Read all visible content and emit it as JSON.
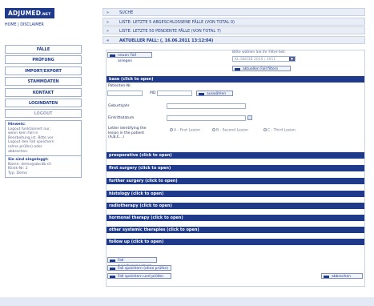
{
  "logo": {
    "text": "ADJUMED",
    "suffix": ".NET"
  },
  "toplinks": {
    "home": "HOME",
    "sep": "|",
    "disclaimer": "DISCLAIMER"
  },
  "nav": [
    {
      "label": "FÄLLE",
      "name": "nav-faelle"
    },
    {
      "label": "PRÜFUNG",
      "name": "nav-pruefung"
    },
    {
      "label": "IMPORT/EXPORT",
      "name": "nav-import-export"
    },
    {
      "label": "STAMMDATEN",
      "name": "nav-stammdaten"
    },
    {
      "label": "KONTAKT",
      "name": "nav-kontakt"
    },
    {
      "label": "LOGINDATEN",
      "name": "nav-logindaten"
    },
    {
      "label": "LOGOUT",
      "name": "nav-logout"
    }
  ],
  "hint": {
    "title": "Hinweis:",
    "lines": [
      "Logout funktioniert nur,",
      "wenn kein Fall in",
      "Bearbeitung ist. Bitte vor",
      "Logout den Fall speichern",
      "(ohne prüfen) oder",
      "abbrechen."
    ]
  },
  "login": {
    "title": "Sie sind eingeloggt:",
    "name": "Name: demo@abcdb.ch",
    "clinic": "Klinik-Nr: 2",
    "type": "Typ: Demo"
  },
  "rows": [
    {
      "label": "SUCHE"
    },
    {
      "label": "LISTE: LETZTE 5 ABGESCHLOSSENE FÄLLE (VON TOTAL 0)"
    },
    {
      "label": "LISTE: LETZTE 50 PENDENTE FÄLLE (VON TOTAL 7)"
    },
    {
      "label": "AKTUELLER FALL: (, 16.06.2011 13:12:04)"
    }
  ],
  "toolbar": {
    "new_case": "neuen Fall anlegen",
    "filter_label": "Bitte wählen Sie Ihr Filter-Set:",
    "filter_value": "KL-SBCDB 2010 / 2011",
    "apply_filter": "aktuellen Fall filtern"
  },
  "base": {
    "header": "base (click to open)",
    "patient_nr": "Patienten-Nr.",
    "pid": "PID",
    "select_btn": "auswählen",
    "birth_year": "Geburtsjahr",
    "entry_date": "Eintrittsdatum",
    "letter_label_1": "Letter identifying the",
    "letter_label_2": "lesion in the patient",
    "letter_label_3": "(A,B,C...)",
    "opt_a": "A - First Lesion",
    "opt_b": "B - Second Lesion",
    "opt_c": "C - Third Lesion"
  },
  "sections": [
    {
      "label": "preoperative (click to open)"
    },
    {
      "label": "first surgery (click to open)"
    },
    {
      "label": "further surgery (click to open)"
    },
    {
      "label": "histology (click to open)"
    },
    {
      "label": "radiotherapy (click to open)"
    },
    {
      "label": "hormonal therapy (click to open)"
    },
    {
      "label": "other systemic therapies (click to open)"
    },
    {
      "label": "follow up (click to open)"
    }
  ],
  "actions": {
    "save_temp": "Fall zwischenspeichern",
    "save_no_check": "Fall speichern (ohne prüfen)",
    "save_check": "Fall speichern und prüfen",
    "cancel": "abbrechen"
  }
}
